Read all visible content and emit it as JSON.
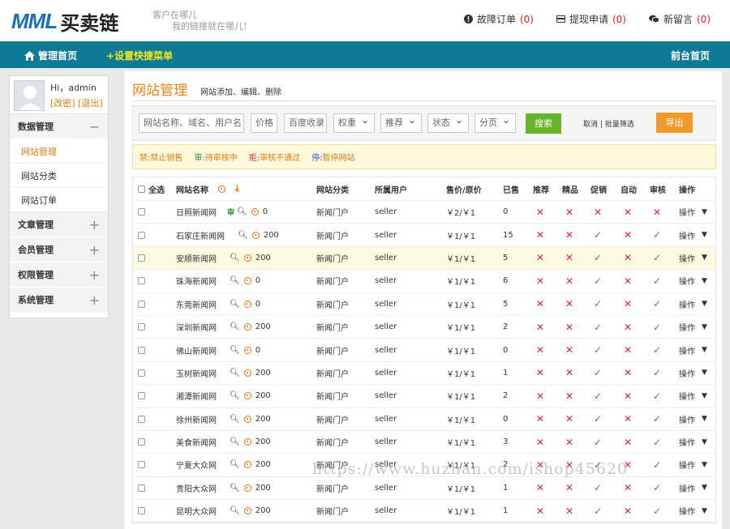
{
  "header": {
    "logo_latin": "MML",
    "logo_cn": "买卖链",
    "slogan_line1": "客户在哪儿",
    "slogan_line2": "我的链接就在哪儿!",
    "links": [
      {
        "label": "故障订单",
        "count": "(0)",
        "icon": "info-icon"
      },
      {
        "label": "提现申请",
        "count": "(0)",
        "icon": "card-icon"
      },
      {
        "label": "新留言",
        "count": "(0)",
        "icon": "chat-icon"
      }
    ]
  },
  "nav": {
    "home": "管理首页",
    "quick_menu": "+设置快捷菜单",
    "front": "前台首页"
  },
  "sidebar": {
    "greeting": "Hi，admin",
    "change_pwd": "[改密]",
    "logout": "[退出]",
    "groups": [
      {
        "label": "数据管理",
        "sign": "−",
        "items": [
          "网站管理",
          "网站分类",
          "网站订单"
        ]
      },
      {
        "label": "文章管理",
        "sign": "+"
      },
      {
        "label": "会员管理",
        "sign": "+"
      },
      {
        "label": "权限管理",
        "sign": "+"
      },
      {
        "label": "系统管理",
        "sign": "+"
      }
    ]
  },
  "page": {
    "title": "网站管理",
    "subtitle": "网站添加、编辑、删除"
  },
  "filter": {
    "keyword_placeholder": "网站名称、域名、用户名",
    "price_placeholder": "价格",
    "baidu_placeholder": "百度收录",
    "selects": [
      "权重",
      "推荐",
      "状态",
      "分页"
    ],
    "search_label": "搜索",
    "cancel_label": "取消",
    "separator": "|",
    "batch_label": "批量筛选",
    "export_label": "导出"
  },
  "legend": [
    {
      "key": "禁:",
      "text": "禁止销售",
      "color": "#e07b16"
    },
    {
      "key": "审:",
      "text": "待审核中",
      "color": "#2e8d3c"
    },
    {
      "key": "拒:",
      "text": "审核不通过",
      "color": "#e0272b"
    },
    {
      "key": "停:",
      "text": "暂停网站",
      "color": "#1a56c4"
    }
  ],
  "table": {
    "headers": {
      "select_all": "全选",
      "name": "网站名称",
      "category": "网站分类",
      "owner": "所属用户",
      "price": "售价/原价",
      "sold": "已售",
      "recommend": "推荐",
      "fine": "精品",
      "promo": "促销",
      "auto": "自动",
      "audit": "审核",
      "action": "操作"
    },
    "audit_badge": "审",
    "action_label": "操作",
    "rows": [
      {
        "name": "日照新闻网",
        "badge": true,
        "score": "0",
        "category": "新闻门户",
        "owner": "seller",
        "price": "￥2/￥1",
        "sold": "0",
        "flags": [
          "x",
          "x",
          "x",
          "x",
          "x"
        ]
      },
      {
        "name": "石家庄新闻网",
        "badge": false,
        "score": "200",
        "category": "新闻门户",
        "owner": "seller",
        "price": "￥1/￥1",
        "sold": "15",
        "flags": [
          "x",
          "x",
          "ok",
          "x",
          "ok"
        ]
      },
      {
        "name": "安顺新闻网",
        "badge": false,
        "score": "200",
        "category": "新闻门户",
        "owner": "seller",
        "price": "￥1/￥1",
        "sold": "5",
        "flags": [
          "x",
          "x",
          "ok",
          "x",
          "ok"
        ]
      },
      {
        "name": "珠海新闻网",
        "badge": false,
        "score": "0",
        "category": "新闻门户",
        "owner": "seller",
        "price": "￥1/￥1",
        "sold": "6",
        "flags": [
          "x",
          "x",
          "ok",
          "x",
          "ok"
        ]
      },
      {
        "name": "东莞新闻网",
        "badge": false,
        "score": "0",
        "category": "新闻门户",
        "owner": "seller",
        "price": "￥1/￥1",
        "sold": "5",
        "flags": [
          "x",
          "x",
          "ok",
          "x",
          "ok"
        ]
      },
      {
        "name": "深圳新闻网",
        "badge": false,
        "score": "200",
        "category": "新闻门户",
        "owner": "seller",
        "price": "￥1/￥1",
        "sold": "2",
        "flags": [
          "x",
          "x",
          "ok",
          "x",
          "ok"
        ]
      },
      {
        "name": "佛山新闻网",
        "badge": false,
        "score": "0",
        "category": "新闻门户",
        "owner": "seller",
        "price": "￥1/￥1",
        "sold": "0",
        "flags": [
          "x",
          "x",
          "ok",
          "x",
          "ok"
        ]
      },
      {
        "name": "玉树新闻网",
        "badge": false,
        "score": "200",
        "category": "新闻门户",
        "owner": "seller",
        "price": "￥1/￥1",
        "sold": "1",
        "flags": [
          "x",
          "x",
          "ok",
          "x",
          "ok"
        ]
      },
      {
        "name": "湘潭新闻网",
        "badge": false,
        "score": "200",
        "category": "新闻门户",
        "owner": "seller",
        "price": "￥1/￥1",
        "sold": "2",
        "flags": [
          "x",
          "x",
          "ok",
          "x",
          "ok"
        ]
      },
      {
        "name": "徐州新闻网",
        "badge": false,
        "score": "200",
        "category": "新闻门户",
        "owner": "seller",
        "price": "￥1/￥1",
        "sold": "0",
        "flags": [
          "x",
          "x",
          "ok",
          "x",
          "ok"
        ]
      },
      {
        "name": "美食新闻网",
        "badge": false,
        "score": "200",
        "category": "新闻门户",
        "owner": "seller",
        "price": "￥1/￥1",
        "sold": "3",
        "flags": [
          "x",
          "x",
          "ok",
          "x",
          "ok"
        ]
      },
      {
        "name": "宁夏大众网",
        "badge": false,
        "score": "200",
        "category": "新闻门户",
        "owner": "seller",
        "price": "￥1/￥1",
        "sold": "2",
        "flags": [
          "x",
          "x",
          "ok",
          "x",
          "ok"
        ]
      },
      {
        "name": "贵阳大众网",
        "badge": false,
        "score": "200",
        "category": "新闻门户",
        "owner": "seller",
        "price": "￥1/￥1",
        "sold": "1",
        "flags": [
          "x",
          "x",
          "ok",
          "x",
          "ok"
        ]
      },
      {
        "name": "昆明大众网",
        "badge": false,
        "score": "200",
        "category": "新闻门户",
        "owner": "seller",
        "price": "￥1/￥1",
        "sold": "1",
        "flags": [
          "x",
          "x",
          "ok",
          "x",
          "ok"
        ]
      }
    ]
  },
  "watermark": "https://www.huzhan.com/ishop45620"
}
